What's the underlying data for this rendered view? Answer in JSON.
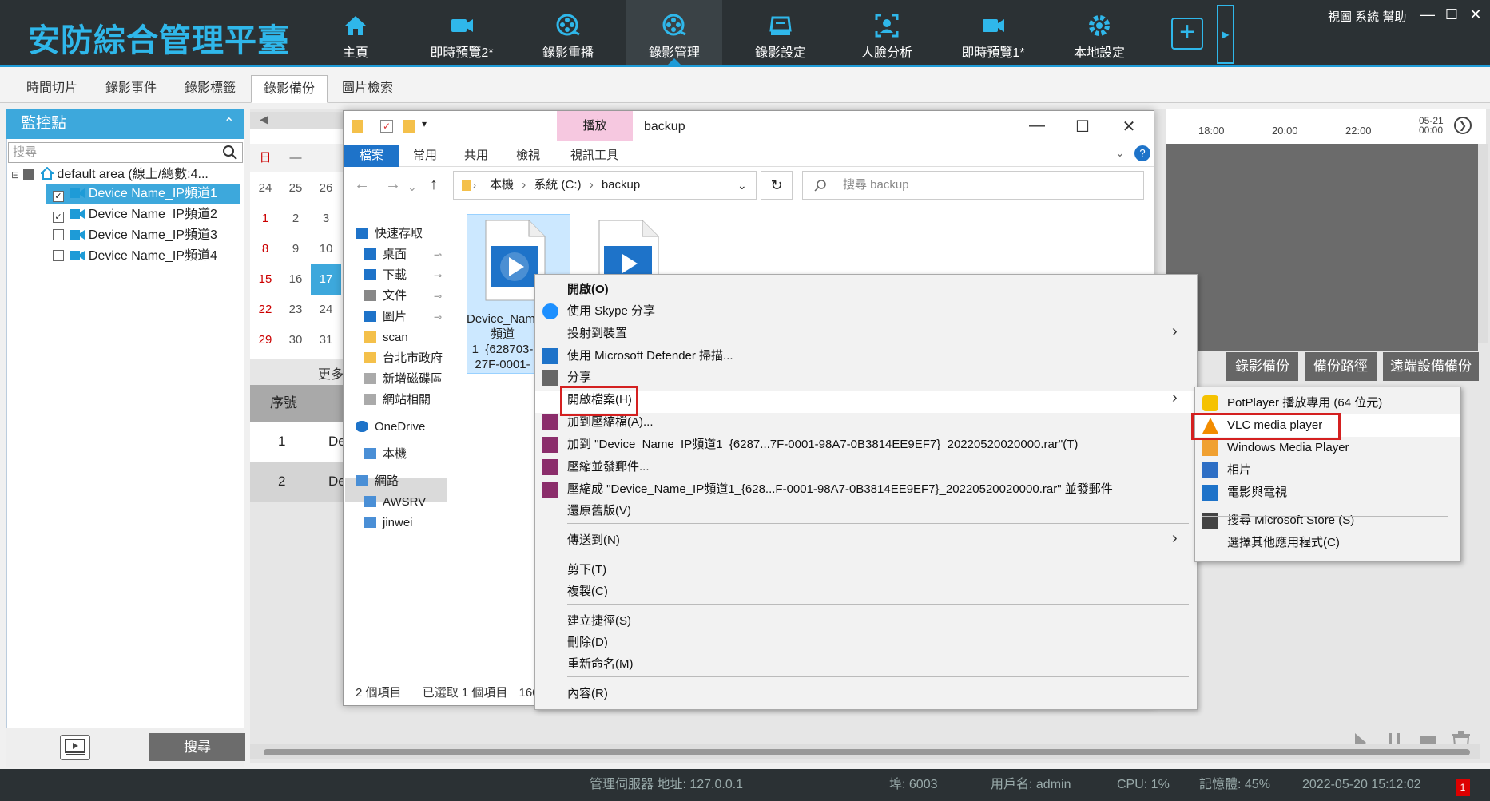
{
  "app": {
    "title": "安防綜合管理平臺",
    "sys_menu": "視圖 系統 幫助",
    "win_min": "—",
    "win_max": "☐",
    "win_close": "✕"
  },
  "nav": [
    {
      "label": "主頁",
      "icon": "home-icon"
    },
    {
      "label": "即時預覽2*",
      "icon": "camera-icon"
    },
    {
      "label": "錄影重播",
      "icon": "film-reel-icon"
    },
    {
      "label": "錄影管理",
      "icon": "film-reel-icon"
    },
    {
      "label": "錄影設定",
      "icon": "dvr-icon"
    },
    {
      "label": "人臉分析",
      "icon": "face-scan-icon"
    },
    {
      "label": "即時預覽1*",
      "icon": "camera-icon"
    },
    {
      "label": "本地設定",
      "icon": "gear-icon"
    }
  ],
  "subtabs": [
    "時間切片",
    "錄影事件",
    "錄影標籤",
    "錄影備份",
    "圖片檢索"
  ],
  "left": {
    "header": "監控點",
    "search_placeholder": "搜尋",
    "root": "default area (線上/總數:4...",
    "devices": [
      {
        "label": "Device Name_IP頻道1",
        "checked": true,
        "selected": true
      },
      {
        "label": "Device Name_IP頻道2",
        "checked": true,
        "selected": false
      },
      {
        "label": "Device Name_IP頻道3",
        "checked": false,
        "selected": false
      },
      {
        "label": "Device Name_IP頻道4",
        "checked": false,
        "selected": false
      }
    ],
    "search_button": "搜尋"
  },
  "calendar": {
    "head": [
      "日",
      "—",
      ""
    ],
    "rows": [
      [
        "24",
        "25",
        "26"
      ],
      [
        "1",
        "2",
        "3"
      ],
      [
        "8",
        "9",
        "10"
      ],
      [
        "15",
        "16",
        "17"
      ],
      [
        "22",
        "23",
        "24"
      ],
      [
        "29",
        "30",
        "31"
      ]
    ],
    "more": "更多"
  },
  "timeline": {
    "ticks": [
      "18:00",
      "20:00",
      "22:00"
    ],
    "end_date": "05-21",
    "end_time": "00:00"
  },
  "actions": [
    "錄影備份",
    "備份路徑",
    "遠端設備備份"
  ],
  "table": {
    "header": "序號",
    "rows": [
      {
        "no": "1",
        "text": "De"
      },
      {
        "no": "2",
        "text": "De"
      }
    ]
  },
  "status": {
    "server": "管理伺服器 地址: 127.0.0.1",
    "port": "埠: 6003",
    "user": "用戶名: admin",
    "cpu": "CPU: 1%",
    "mem": "記憶體: 45%",
    "time": "2022-05-20 15:12:02",
    "alerts": "1"
  },
  "explorer": {
    "title": "backup",
    "context_tab": "播放",
    "ribbon_tabs": [
      "檔案",
      "常用",
      "共用",
      "檢視",
      "視訊工具"
    ],
    "address": [
      "本機",
      "系統 (C:)",
      "backup"
    ],
    "search_placeholder": "搜尋 backup",
    "nav": [
      {
        "label": "快速存取",
        "icon": "star-icon",
        "pin": false
      },
      {
        "label": "桌面",
        "icon": "desktop-icon",
        "pin": true
      },
      {
        "label": "下載",
        "icon": "download-icon",
        "pin": true
      },
      {
        "label": "文件",
        "icon": "document-icon",
        "pin": true
      },
      {
        "label": "圖片",
        "icon": "picture-icon",
        "pin": true
      },
      {
        "label": "scan",
        "icon": "folder-icon",
        "pin": false
      },
      {
        "label": "台北市政府",
        "icon": "folder-icon",
        "pin": false
      },
      {
        "label": "新增磁碟區",
        "icon": "drive-icon",
        "pin": false
      },
      {
        "label": "網站相關",
        "icon": "drive-icon",
        "pin": false
      },
      {
        "label": "OneDrive",
        "icon": "cloud-icon",
        "pin": false
      },
      {
        "label": "本機",
        "icon": "computer-icon",
        "pin": false
      },
      {
        "label": "網路",
        "icon": "network-icon",
        "pin": false
      },
      {
        "label": "AWSRV",
        "icon": "computer-icon",
        "pin": false
      },
      {
        "label": "jinwei",
        "icon": "computer-icon",
        "pin": false
      }
    ],
    "file_name": "Device_Name_IP頻道1_{628703-27F-0001-",
    "status": [
      "2 個項目",
      "已選取 1 個項目",
      "160"
    ]
  },
  "context_menu": [
    {
      "label": "開啟(O)",
      "icon": "",
      "bold": true
    },
    {
      "label": "使用 Skype 分享",
      "icon": "skype-icon"
    },
    {
      "label": "投射到裝置",
      "icon": "",
      "submenu": true
    },
    {
      "label": "使用 Microsoft Defender 掃描...",
      "icon": "defender-icon"
    },
    {
      "label": "分享",
      "icon": "share-icon"
    },
    {
      "label": "開啟檔案(H)",
      "icon": "",
      "submenu": true,
      "highlight": true
    },
    {
      "label": "加到壓縮檔(A)...",
      "icon": "winrar-icon"
    },
    {
      "label": "加到 \"Device_Name_IP頻道1_{6287...7F-0001-98A7-0B3814EE9EF7}_20220520020000.rar\"(T)",
      "icon": "winrar-icon"
    },
    {
      "label": "壓縮並發郵件...",
      "icon": "winrar-icon"
    },
    {
      "label": "壓縮成 \"Device_Name_IP頻道1_{628...F-0001-98A7-0B3814EE9EF7}_20220520020000.rar\" 並發郵件",
      "icon": "winrar-icon"
    },
    {
      "label": "還原舊版(V)",
      "icon": ""
    },
    {
      "label": "傳送到(N)",
      "icon": "",
      "submenu": true
    },
    {
      "label": "剪下(T)",
      "icon": ""
    },
    {
      "label": "複製(C)",
      "icon": ""
    },
    {
      "label": "建立捷徑(S)",
      "icon": ""
    },
    {
      "label": "刪除(D)",
      "icon": ""
    },
    {
      "label": "重新命名(M)",
      "icon": ""
    },
    {
      "label": "內容(R)",
      "icon": ""
    }
  ],
  "open_with": [
    {
      "label": "PotPlayer 播放專用 (64 位元)",
      "icon": "potplayer-icon"
    },
    {
      "label": "VLC media player",
      "icon": "vlc-icon",
      "highlight": true
    },
    {
      "label": "Windows Media Player",
      "icon": "wmp-icon"
    },
    {
      "label": "相片",
      "icon": "photos-icon"
    },
    {
      "label": "電影與電視",
      "icon": "movies-icon"
    },
    {
      "label": "搜尋 Microsoft Store (S)",
      "icon": "store-icon"
    },
    {
      "label": "選擇其他應用程式(C)",
      "icon": ""
    }
  ],
  "colors": {
    "accent": "#2fb7ea",
    "topbar": "#2b3134",
    "highlight_box": "#d42020",
    "ribbon_file": "#1e73c9"
  }
}
